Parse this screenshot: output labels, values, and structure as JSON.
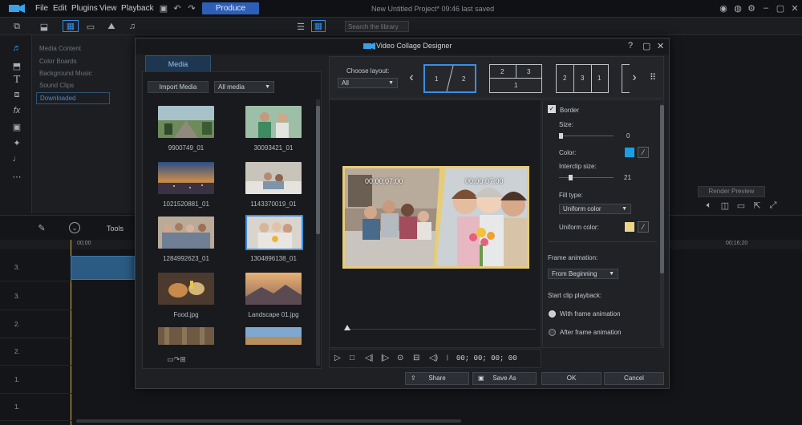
{
  "app": {
    "menu": [
      "File",
      "Edit",
      "Plugins",
      "View",
      "Playback"
    ],
    "produce_label": "Produce",
    "project_title": "New Untitled Project* 09:46 last saved",
    "search_placeholder": "Search the library"
  },
  "library": {
    "items": [
      "Media Content",
      "Color Boards",
      "Background Music",
      "Sound Clips",
      "Downloaded"
    ]
  },
  "right_panel": {
    "render_preview_label": "Render Preview"
  },
  "timeline": {
    "tools_label": "Tools",
    "ruler_start": "00;00",
    "ruler_mark": "00;16;20",
    "tracks": [
      "3.",
      "3.",
      "2.",
      "2.",
      "1.",
      "1."
    ]
  },
  "dialog": {
    "title": "Video Collage Designer",
    "help": "?",
    "media_tab": "Media",
    "import_label": "Import Media",
    "filter_value": "All media",
    "media_items": [
      {
        "label": "9900749_01"
      },
      {
        "label": "30093421_01"
      },
      {
        "label": "1021520881_01"
      },
      {
        "label": "1143370019_01"
      },
      {
        "label": "1284992623_01"
      },
      {
        "label": "1304896138_01"
      },
      {
        "label": "Food.jpg"
      },
      {
        "label": "Landscape 01.jpg"
      }
    ],
    "choose_layout_label": "Choose layout:",
    "layout_filter": "All",
    "layouts": [
      {
        "cells": [
          "1",
          "2"
        ]
      },
      {
        "cells": [
          "2",
          "3",
          "1"
        ]
      },
      {
        "cells": [
          "2",
          "3",
          "1"
        ]
      }
    ],
    "preview": {
      "timecode_left": "00;00;07;00",
      "timecode_right": "00;00;07;00",
      "player_time": "00; 00; 00; 00"
    },
    "settings": {
      "border_label": "Border",
      "size_label": "Size:",
      "size_value": "0",
      "color_label": "Color:",
      "interclip_label": "Interclip size:",
      "interclip_value": "21",
      "fill_type_label": "Fill type:",
      "fill_type_value": "Uniform color",
      "uniform_color_label": "Uniform color:",
      "frame_animation_label": "Frame animation:",
      "frame_animation_value": "From Beginning",
      "start_playback_label": "Start clip playback:",
      "option_with": "With frame animation",
      "option_after": "After frame animation",
      "border_color": "#1a9ee8",
      "fill_color": "#ecd488"
    },
    "buttons": {
      "share": "Share",
      "save_as": "Save As",
      "ok": "OK",
      "cancel": "Cancel"
    }
  }
}
